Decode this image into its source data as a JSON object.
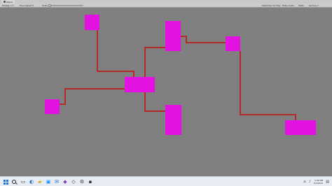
{
  "tabs": [
    {
      "label": "Game"
    }
  ],
  "toolbar": {
    "display": "Display 1",
    "aspect": "Free Aspect",
    "scale_label": "Scale",
    "scale_value": 1.0,
    "maximize": "Maximize On Play",
    "mute": "Mute Audio",
    "stats": "Stats",
    "gizmos": "Gizmos"
  },
  "scene": {
    "background": "#808080",
    "node_color": "#e312e3",
    "edge_color": "#b22a2a"
  },
  "taskbar": {
    "icons": [
      "windows-start-icon",
      "search-icon",
      "task-view-icon",
      "edge-browser-icon",
      "file-explorer-icon",
      "store-icon",
      "mail-icon",
      "visual-studio-icon",
      "unity-icon",
      "settings-icon",
      "terminal-icon"
    ],
    "time": "1:29 PM",
    "date": "5/7/2021"
  }
}
